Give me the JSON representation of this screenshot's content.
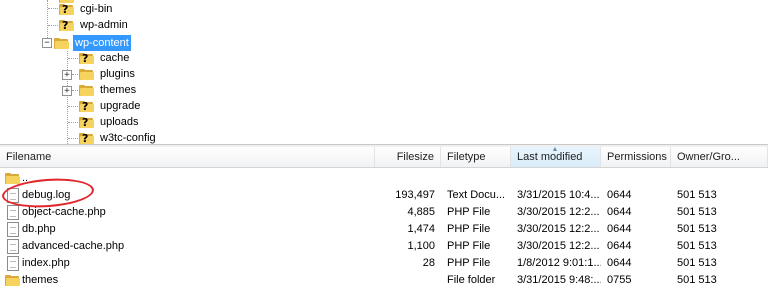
{
  "tree": {
    "nodes": [
      {
        "label": "cgi-bin",
        "icon": "unknown-folder-icon"
      },
      {
        "label": "wp-admin",
        "icon": "unknown-folder-icon"
      },
      {
        "label": "wp-content",
        "icon": "folder-icon",
        "selected": true,
        "expander": "−"
      },
      {
        "label": "cache",
        "icon": "unknown-folder-icon"
      },
      {
        "label": "plugins",
        "icon": "folder-icon",
        "expander": "+"
      },
      {
        "label": "themes",
        "icon": "folder-icon",
        "expander": "+"
      },
      {
        "label": "upgrade",
        "icon": "unknown-folder-icon"
      },
      {
        "label": "uploads",
        "icon": "unknown-folder-icon"
      },
      {
        "label": "w3tc-config",
        "icon": "unknown-folder-icon"
      }
    ]
  },
  "filelist": {
    "columns": {
      "filename": "Filename",
      "filesize": "Filesize",
      "filetype": "Filetype",
      "last_modified": "Last modified",
      "permissions": "Permissions",
      "owner_group": "Owner/Gro..."
    },
    "sorted_column": "Last modified",
    "rows": [
      {
        "name": "..",
        "size": "",
        "type": "",
        "modified": "",
        "perms": "",
        "owner": "",
        "icon": "folder-icon"
      },
      {
        "name": "debug.log",
        "size": "193,497",
        "type": "Text Docu...",
        "modified": "3/31/2015 10:4...",
        "perms": "0644",
        "owner": "501 513",
        "icon": "file-icon"
      },
      {
        "name": "object-cache.php",
        "size": "4,885",
        "type": "PHP File",
        "modified": "3/30/2015 12:2...",
        "perms": "0644",
        "owner": "501 513",
        "icon": "file-icon"
      },
      {
        "name": "db.php",
        "size": "1,474",
        "type": "PHP File",
        "modified": "3/30/2015 12:2...",
        "perms": "0644",
        "owner": "501 513",
        "icon": "file-icon"
      },
      {
        "name": "advanced-cache.php",
        "size": "1,100",
        "type": "PHP File",
        "modified": "3/30/2015 12:2...",
        "perms": "0644",
        "owner": "501 513",
        "icon": "file-icon"
      },
      {
        "name": "index.php",
        "size": "28",
        "type": "PHP File",
        "modified": "1/8/2012 9:01:1...",
        "perms": "0644",
        "owner": "501 513",
        "icon": "file-icon"
      },
      {
        "name": "themes",
        "size": "",
        "type": "File folder",
        "modified": "3/31/2015 9:48:...",
        "perms": "0755",
        "owner": "501 513",
        "icon": "folder-icon"
      }
    ]
  },
  "colors": {
    "selection": "#3399ff",
    "annotation": "#e0252b",
    "folder": "#f5d35e"
  }
}
